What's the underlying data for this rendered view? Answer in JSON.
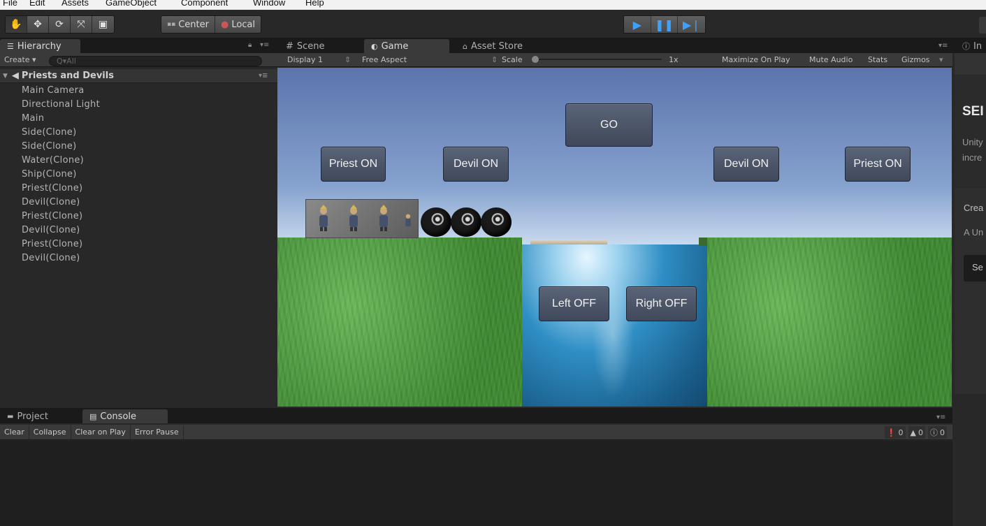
{
  "menu": [
    "File",
    "Edit",
    "Assets",
    "GameObject",
    "Component",
    "Window",
    "Help"
  ],
  "toolbar": {
    "pivot_label": "Center",
    "space_label": "Local"
  },
  "hierarchy": {
    "tab_label": "Hierarchy",
    "create_label": "Create",
    "search_placeholder": "Q▾All",
    "scene_name": "Priests and Devils",
    "items": [
      "Main Camera",
      "Directional Light",
      "Main",
      "Side(Clone)",
      "Side(Clone)",
      "Water(Clone)",
      "Ship(Clone)",
      "Priest(Clone)",
      "Devil(Clone)",
      "Priest(Clone)",
      "Devil(Clone)",
      "Priest(Clone)",
      "Devil(Clone)"
    ]
  },
  "game_panel": {
    "tabs": {
      "scene": "Scene",
      "game": "Game",
      "asset_store": "Asset Store"
    },
    "display": "Display 1",
    "aspect": "Free Aspect",
    "scale_label": "Scale",
    "scale_value": "1x",
    "options": [
      "Maximize On Play",
      "Mute Audio",
      "Stats",
      "Gizmos"
    ]
  },
  "game_ui": {
    "go": "GO",
    "left_priest": "Priest ON",
    "left_devil": "Devil ON",
    "right_devil": "Devil ON",
    "right_priest": "Priest ON",
    "left_off": "Left OFF",
    "right_off": "Right OFF"
  },
  "inspector": {
    "tab_label": "In",
    "heading": "SEI",
    "line1": "Unity",
    "line2": "incre",
    "line3": "Crea",
    "line4": "A Un",
    "button": "Se"
  },
  "console": {
    "tabs": {
      "project": "Project",
      "console": "Console"
    },
    "buttons": [
      "Clear",
      "Collapse",
      "Clear on Play",
      "Error Pause"
    ],
    "counts": {
      "errors": "0",
      "warnings": "0",
      "logs": "0"
    }
  },
  "colors": {
    "play_blue": "#3da2ff",
    "editor_bg": "#282828",
    "grass": "#4f9b3f",
    "water": "#2f8ec4"
  }
}
